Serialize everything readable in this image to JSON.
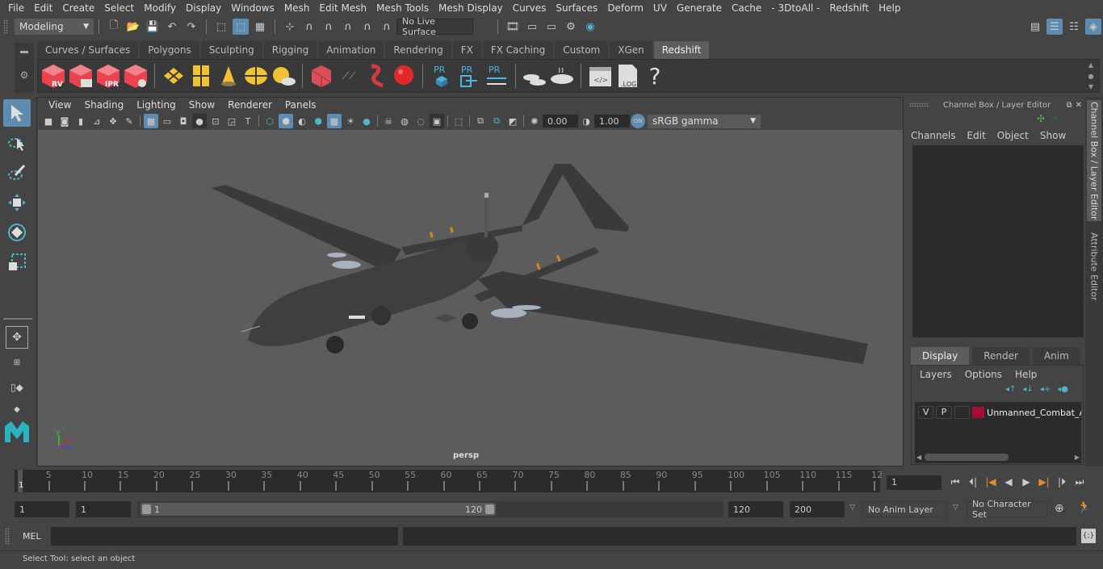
{
  "menubar": [
    "File",
    "Edit",
    "Create",
    "Select",
    "Modify",
    "Display",
    "Windows",
    "Mesh",
    "Edit Mesh",
    "Mesh Tools",
    "Mesh Display",
    "Curves",
    "Surfaces",
    "Deform",
    "UV",
    "Generate",
    "Cache",
    "- 3DtoAll -",
    "Redshift",
    "Help"
  ],
  "statusline": {
    "workspace": "Modeling",
    "live_surface": "No Live Surface"
  },
  "shelf": {
    "tabs": [
      "Curves / Surfaces",
      "Polygons",
      "Sculpting",
      "Rigging",
      "Animation",
      "Rendering",
      "FX",
      "FX Caching",
      "Custom",
      "XGen",
      "Redshift"
    ],
    "active_tab": "Redshift",
    "icons": [
      "rs-render-view",
      "rs-batch-render",
      "rs-ipr",
      "rs-settings",
      "rs-area-light",
      "rs-rect-light",
      "rs-spot-light",
      "rs-dome-light",
      "rs-sun-sky",
      "rs-proxy",
      "rs-volume",
      "rs-hair",
      "rs-sphere",
      "pr-cube",
      "pr-export",
      "pr-swap",
      "bake-multi",
      "bake",
      "script-editor",
      "log",
      "help"
    ],
    "icon_labels": {
      "rv": "RV",
      "ipr": "IPR",
      "pr": "PR",
      "log": ".LOG",
      "help": "?"
    }
  },
  "viewport": {
    "menu": [
      "View",
      "Shading",
      "Lighting",
      "Show",
      "Renderer",
      "Panels"
    ],
    "exposure": "0.00",
    "gamma": "1.00",
    "color_mgmt": "ON",
    "color_space": "sRGB gamma",
    "camera": "persp",
    "axis": {
      "x": "x",
      "y": "y",
      "z": "z"
    }
  },
  "channelbox": {
    "title": "Channel Box / Layer Editor",
    "menu": [
      "Channels",
      "Edit",
      "Object",
      "Show"
    ],
    "layer_tabs": [
      "Display",
      "Render",
      "Anim"
    ],
    "active_layer_tab": "Display",
    "layer_menu": [
      "Layers",
      "Options",
      "Help"
    ],
    "layers": [
      {
        "v": "V",
        "p": "P",
        "color": "#a50f2f",
        "name": "Unmanned_Combat_A"
      }
    ]
  },
  "side_tabs": [
    "Channel Box / Layer Editor",
    "Attribute Editor"
  ],
  "timeline": {
    "ticks": [
      "5",
      "10",
      "15",
      "20",
      "25",
      "30",
      "35",
      "40",
      "45",
      "50",
      "55",
      "60",
      "65",
      "70",
      "75",
      "80",
      "85",
      "90",
      "95",
      "100",
      "105",
      "110",
      "115",
      "12"
    ],
    "current_frame_marker": "1",
    "current_frame": "1"
  },
  "range": {
    "start": "1",
    "playback_start": "1",
    "slider_start": "1",
    "slider_end": "120",
    "playback_end": "120",
    "end": "200",
    "anim_layer": "No Anim Layer",
    "character_set": "No Character Set"
  },
  "command": {
    "lang": "MEL"
  },
  "help_line": "Select Tool: select an object",
  "colors": {
    "accent": "#5e8bb0",
    "redshift": "#e8434f",
    "light": "#f1c232",
    "layer": "#a50f2f"
  }
}
